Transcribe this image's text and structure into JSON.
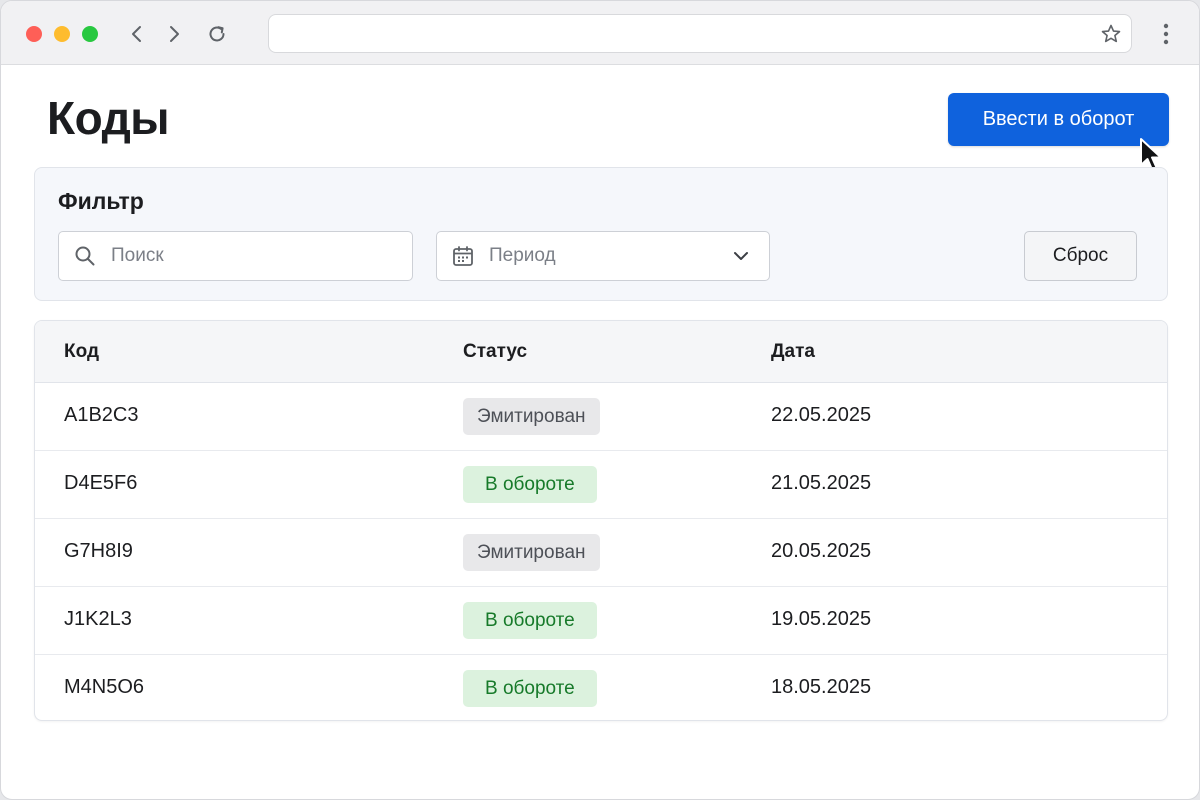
{
  "page": {
    "title": "Коды",
    "primary_action_label": "Ввести в оборот"
  },
  "filter": {
    "title": "Фильтр",
    "search_placeholder": "Поиск",
    "period_placeholder": "Период",
    "reset_label": "Сброс"
  },
  "table": {
    "headers": {
      "code": "Код",
      "status": "Статус",
      "date": "Дата"
    },
    "rows": [
      {
        "code": "A1B2C3",
        "status": "Эмитирован",
        "status_kind": "emitted",
        "date": "22.05.2025"
      },
      {
        "code": "D4E5F6",
        "status": "В обороте",
        "status_kind": "active",
        "date": "21.05.2025"
      },
      {
        "code": "G7H8I9",
        "status": "Эмитирован",
        "status_kind": "emitted",
        "date": "20.05.2025"
      },
      {
        "code": "J1K2L3",
        "status": "В обороте",
        "status_kind": "active",
        "date": "19.05.2025"
      },
      {
        "code": "M4N5O6",
        "status": "В обороте",
        "status_kind": "active",
        "date": "18.05.2025"
      }
    ]
  },
  "icons": {
    "back": "chevron-left-icon",
    "forward": "chevron-right-icon",
    "reload": "reload-icon",
    "bookmark": "star-icon",
    "menu": "kebab-menu-icon",
    "search": "search-icon",
    "calendar": "calendar-icon",
    "dropdown": "chevron-down-icon",
    "cursor": "mouse-pointer-icon"
  },
  "colors": {
    "primary": "#0f62dd",
    "badge_emitted_bg": "#e8e8ea",
    "badge_emitted_text": "#4d5057",
    "badge_active_bg": "#dcf2de",
    "badge_active_text": "#177a2a",
    "traffic_red": "#fe5f57",
    "traffic_yellow": "#febc2e",
    "traffic_green": "#28c840"
  }
}
